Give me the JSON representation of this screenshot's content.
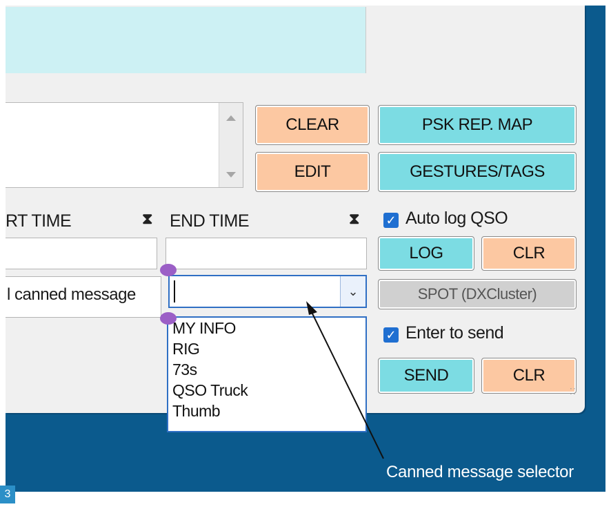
{
  "buttons": {
    "clear": "CLEAR",
    "edit": "EDIT",
    "psk_rep_map": "PSK REP. MAP",
    "gestures_tags": "GESTURES/TAGS",
    "log": "LOG",
    "log_clr": "CLR",
    "spot": "SPOT (DXCluster)",
    "send": "SEND",
    "send_clr": "CLR"
  },
  "labels": {
    "start_time": "RT TIME",
    "end_time": "END TIME",
    "hourglass": "⧗",
    "canned_label": "l canned message"
  },
  "checkboxes": {
    "auto_log": {
      "label": "Auto log QSO",
      "checked": true
    },
    "enter_to_send": {
      "label": "Enter to send",
      "checked": true
    }
  },
  "canned_dropdown": {
    "value": "",
    "options": [
      "MY INFO",
      "RIG",
      "73s",
      "QSO Truck",
      "Thumb"
    ]
  },
  "annotation": {
    "caption": "Canned message selector",
    "figure_number": "3"
  },
  "colors": {
    "orange_button": "#fcc8a2",
    "cyan_button": "#7cdce3",
    "receive_pane": "#cdf1f4",
    "background": "#0b5a8d",
    "focus_blue": "#2f6fc4",
    "handle_purple": "#9b5fc6"
  }
}
